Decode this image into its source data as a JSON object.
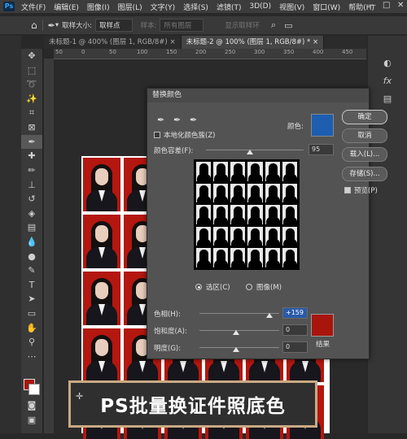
{
  "menubar": {
    "app_icon": "Ps",
    "items": [
      "文件(F)",
      "编辑(E)",
      "图像(I)",
      "图层(L)",
      "文字(Y)",
      "选择(S)",
      "滤镜(T)",
      "3D(D)",
      "视图(V)",
      "窗口(W)",
      "帮助(H)"
    ],
    "window_controls": [
      "—",
      "□",
      "✕"
    ]
  },
  "options": {
    "sample_size_label": "取样大小:",
    "sample_size_value": "取样点",
    "sample_label": "样本:",
    "sample_value": "所有图层",
    "show_ring": "显示取样环"
  },
  "tabs": [
    {
      "label": "未标题-1 @ 400% (图层 1, RGB/8#) ×"
    },
    {
      "label": "未标题-2 @ 100% (图层 1, RGB/8#) * ×"
    }
  ],
  "ruler": {
    "ticks": [
      "50",
      "0",
      "50",
      "100",
      "150",
      "200",
      "250",
      "300",
      "350",
      "400",
      "450"
    ]
  },
  "dialog": {
    "title": "替换颜色",
    "localized_clusters": "本地化颜色簇(Z)",
    "color_label": "颜色:",
    "fuzziness_label": "颜色容差(F):",
    "fuzziness_value": "95",
    "fuzziness": 0.95,
    "radio_selection": "选区(C)",
    "radio_image": "图像(M)",
    "hue_label": "色相(H):",
    "hue_value": "+159",
    "saturation_label": "饱和度(A):",
    "saturation_value": "0",
    "lightness_label": "明度(G):",
    "lightness_value": "0",
    "result_label": "结果",
    "ok": "确定",
    "cancel": "取消",
    "load": "载入(L)...",
    "save": "存储(S)...",
    "preview": "预览(P)",
    "preview_checked": true,
    "localized_checked": false,
    "selected_color": "#1d5eb1",
    "result_color": "#a8150c"
  },
  "banner": {
    "text": "PS批量换证件照底色"
  },
  "colors": {
    "foreground": "#a8150c",
    "background": "#ffffff",
    "photo_bg": "#b3170f"
  }
}
